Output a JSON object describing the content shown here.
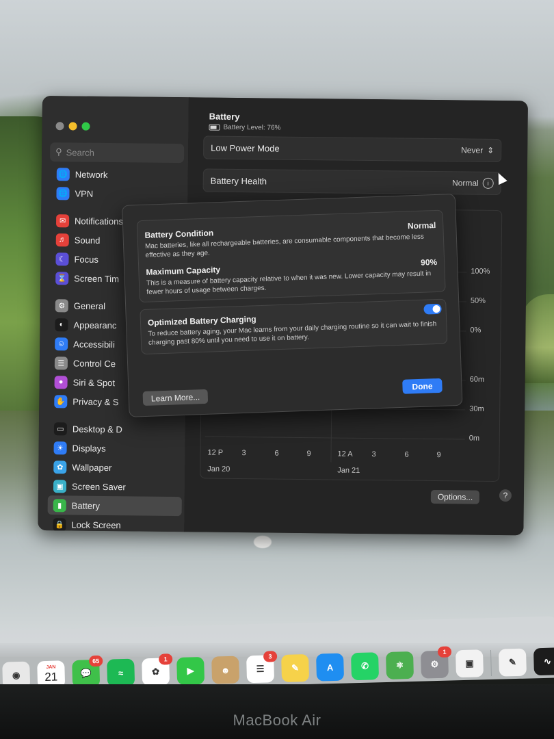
{
  "window": {
    "title": "Battery",
    "battery_level": "Battery Level: 76%",
    "search_placeholder": "Search",
    "sidebar": [
      {
        "label": "Network",
        "icon": "network-icon",
        "color": "#2f7cf6"
      },
      {
        "label": "VPN",
        "icon": "vpn-icon",
        "color": "#2f7cf6"
      },
      {
        "label": "Notifications",
        "icon": "bell-icon",
        "color": "#e5413a"
      },
      {
        "label": "Sound",
        "icon": "speaker-icon",
        "color": "#e5413a"
      },
      {
        "label": "Focus",
        "icon": "moon-icon",
        "color": "#5b4fd6"
      },
      {
        "label": "Screen Tim",
        "icon": "hourglass-icon",
        "color": "#5b4fd6"
      },
      {
        "label": "General",
        "icon": "gear-icon",
        "color": "#8a8a8a"
      },
      {
        "label": "Appearanc",
        "icon": "appearance-icon",
        "color": "#1c1c1c"
      },
      {
        "label": "Accessibili",
        "icon": "accessibility-icon",
        "color": "#2f7cf6"
      },
      {
        "label": "Control Ce",
        "icon": "control-center-icon",
        "color": "#8a8a8a"
      },
      {
        "label": "Siri & Spot",
        "icon": "siri-icon",
        "color": "#b14fd6"
      },
      {
        "label": "Privacy & S",
        "icon": "hand-icon",
        "color": "#2f7cf6"
      },
      {
        "label": "Desktop & D",
        "icon": "desktop-icon",
        "color": "#1c1c1c"
      },
      {
        "label": "Displays",
        "icon": "sun-icon",
        "color": "#2f7cf6"
      },
      {
        "label": "Wallpaper",
        "icon": "flower-icon",
        "color": "#3aa3e8"
      },
      {
        "label": "Screen Saver",
        "icon": "screen-saver-icon",
        "color": "#3ab0c8"
      },
      {
        "label": "Battery",
        "icon": "battery-icon",
        "color": "#39b54a"
      },
      {
        "label": "Lock Screen",
        "icon": "lock-icon",
        "color": "#1c1c1c"
      }
    ],
    "low_power": {
      "label": "Low Power Mode",
      "value": "Never"
    },
    "health": {
      "label": "Battery Health",
      "value": "Normal"
    },
    "chart": {
      "y_pct": [
        "100%",
        "50%",
        "0%"
      ],
      "y_min": [
        "60m",
        "30m",
        "0m"
      ],
      "x_ticks": [
        "12 P",
        "3",
        "6",
        "9",
        "12 A",
        "3",
        "6",
        "9"
      ],
      "x_dates": [
        "Jan 20",
        "Jan 21"
      ]
    },
    "options_label": "Options...",
    "help_label": "?"
  },
  "sheet": {
    "condition": {
      "title": "Battery Condition",
      "value": "Normal",
      "desc": "Mac batteries, like all rechargeable batteries, are consumable components that become less effective as they age."
    },
    "capacity": {
      "title": "Maximum Capacity",
      "value": "90%",
      "desc": "This is a measure of battery capacity relative to when it was new. Lower capacity may result in fewer hours of usage between charges."
    },
    "optimized": {
      "title": "Optimized Battery Charging",
      "enabled": true,
      "desc": "To reduce battery aging, your Mac learns from your daily charging routine so it can wait to finish charging past 80% until you need to use it on battery."
    },
    "learn_more": "Learn More...",
    "done": "Done"
  },
  "dock": [
    {
      "name": "chrome",
      "icon": "chrome-icon",
      "color": "#e8e8e8",
      "badge": ""
    },
    {
      "name": "calendar",
      "icon": "calendar-icon",
      "color": "#ffffff",
      "badge": "",
      "month": "JAN",
      "day": "21"
    },
    {
      "name": "messages",
      "icon": "messages-icon",
      "color": "#3fc04a",
      "badge": "65"
    },
    {
      "name": "spotify",
      "icon": "spotify-icon",
      "color": "#1db954",
      "badge": ""
    },
    {
      "name": "photos",
      "icon": "photos-icon",
      "color": "#ffffff",
      "badge": "1"
    },
    {
      "name": "facetime",
      "icon": "facetime-icon",
      "color": "#33c748",
      "badge": ""
    },
    {
      "name": "contacts",
      "icon": "contacts-icon",
      "color": "#c9a26b",
      "badge": ""
    },
    {
      "name": "reminders",
      "icon": "reminders-icon",
      "color": "#ffffff",
      "badge": "3"
    },
    {
      "name": "notes",
      "icon": "notes-icon",
      "color": "#f6d24a",
      "badge": ""
    },
    {
      "name": "app-store",
      "icon": "app-store-icon",
      "color": "#1f8ef1",
      "badge": ""
    },
    {
      "name": "whatsapp",
      "icon": "whatsapp-icon",
      "color": "#25d366",
      "badge": ""
    },
    {
      "name": "atom",
      "icon": "atom-icon",
      "color": "#4caf50",
      "badge": ""
    },
    {
      "name": "system-settings",
      "icon": "settings-gear-icon",
      "color": "#8e8e93",
      "badge": "1"
    },
    {
      "name": "screenshot",
      "icon": "camera-icon",
      "color": "#f2f2f2",
      "badge": ""
    },
    {
      "name": "script-editor",
      "icon": "pen-icon",
      "color": "#f2f2f2",
      "badge": ""
    },
    {
      "name": "activity-monitor",
      "icon": "activity-icon",
      "color": "#1c1c1c",
      "badge": ""
    }
  ],
  "device_label": "MacBook Air"
}
